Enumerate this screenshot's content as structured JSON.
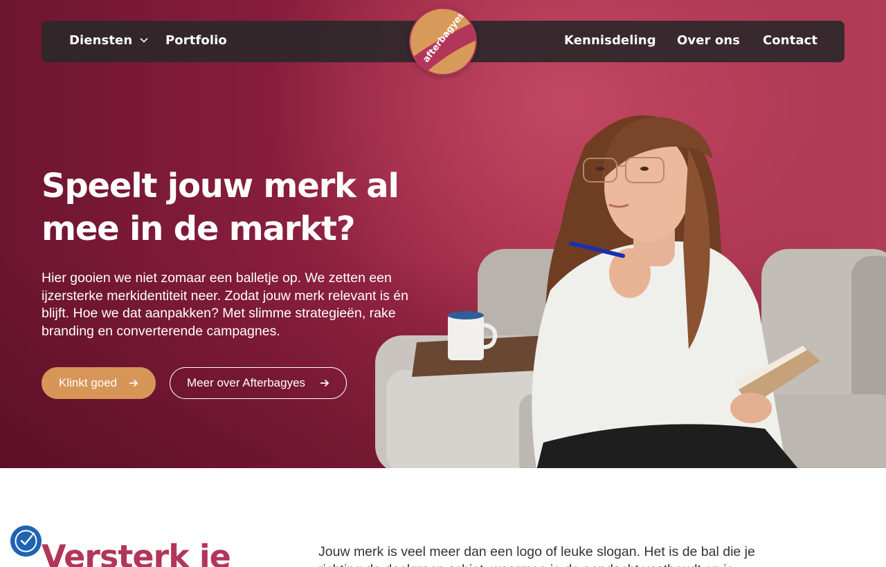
{
  "nav": {
    "left_items": [
      {
        "label": "Diensten",
        "has_dropdown": true
      },
      {
        "label": "Portfolio",
        "has_dropdown": false
      }
    ],
    "right_items": [
      {
        "label": "Kennisdeling"
      },
      {
        "label": "Over ons"
      },
      {
        "label": "Contact"
      }
    ],
    "logo_text": "afterbagyes."
  },
  "hero": {
    "title": "Speelt jouw merk al mee in de markt?",
    "text": "Hier gooien we niet zomaar een balletje op. We zetten een ijzersterke merkidentiteit neer. Zodat jouw merk relevant is én blijft. Hoe we dat aanpakken? Met slimme strategieën, rake branding en converterende campagnes.",
    "primary_button": "Klinkt goed",
    "secondary_button": "Meer over Afterbagyes",
    "icons": {
      "button_arrow": "arrow-right-icon"
    }
  },
  "section": {
    "title": "Versterk je",
    "text": "Jouw merk is veel meer dan een logo of leuke slogan. Het is de bal die je richting de doelgroep schiet, waarmee je de aandacht vasthoudt en je"
  },
  "colors": {
    "brand_magenta": "#b2365a",
    "brand_orange": "#d89558",
    "nav_bg": "#2d282a",
    "a11y_blue": "#1f63b3"
  }
}
